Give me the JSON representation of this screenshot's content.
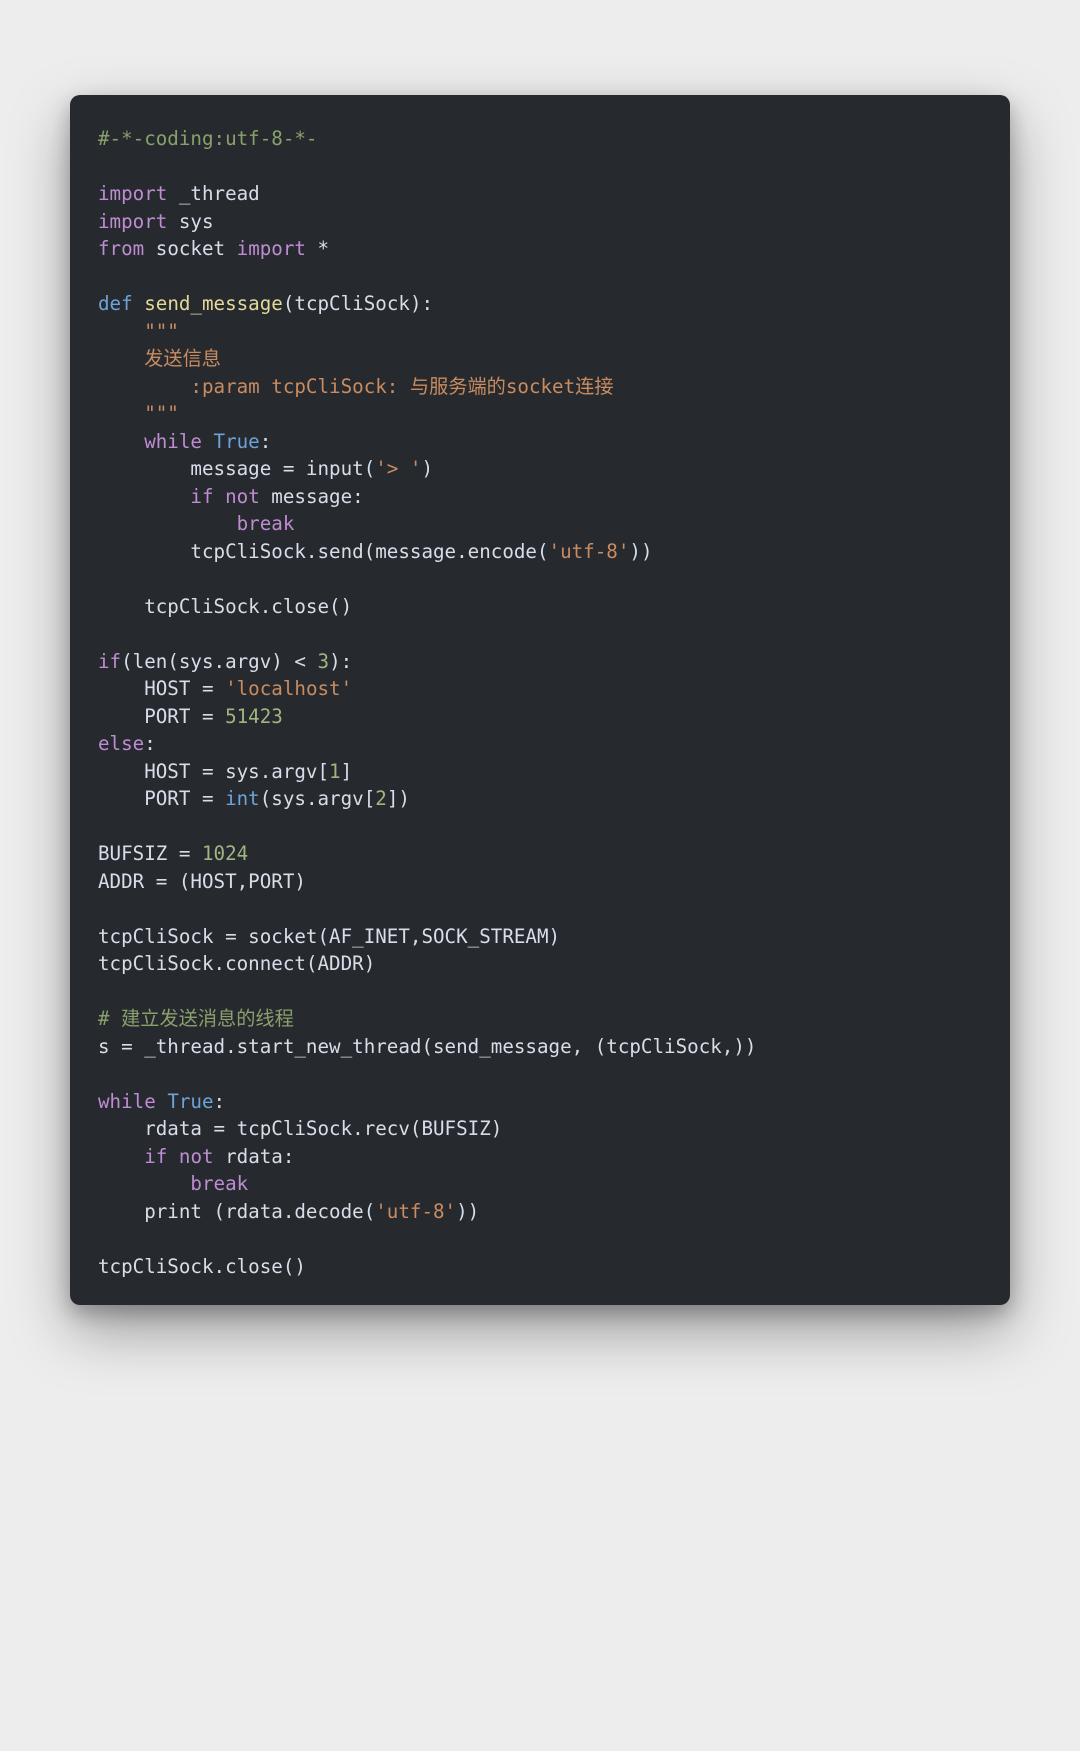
{
  "code": {
    "l01_comment": "#-*-coding:utf-8-*-",
    "l02_blank": "",
    "l03_import": "import",
    "l03_mod": " _thread",
    "l04_import": "import",
    "l04_mod": " sys",
    "l05_from": "from",
    "l05_mod": " socket ",
    "l05_import": "import",
    "l05_star": " *",
    "l06_blank": "",
    "l07_def": "def",
    "l07_space": " ",
    "l07_fn": "send_message",
    "l07_params_open": "(",
    "l07_param": "tcpCliSock",
    "l07_params_close": "):",
    "l08_doc": "    \"\"\"",
    "l09_doc": "    发送信息",
    "l10_doc": "        :param tcpCliSock: 与服务端的socket连接",
    "l11_doc": "    \"\"\"",
    "l12_while": "    while",
    "l12_space": " ",
    "l12_true": "True",
    "l12_colon": ":",
    "l13_indent": "        message = input(",
    "l13_str": "'> '",
    "l13_close": ")",
    "l14_indent": "        ",
    "l14_if": "if",
    "l14_space": " ",
    "l14_not": "not",
    "l14_rest": " message:",
    "l15_indent": "            ",
    "l15_break": "break",
    "l16_indent": "        tcpCliSock.send(message.encode(",
    "l16_str": "'utf-8'",
    "l16_close": "))",
    "l17_blank": "",
    "l18_line": "    tcpCliSock.close()",
    "l19_blank": "",
    "l20_if": "if",
    "l20_rest1": "(len(sys.argv) < ",
    "l20_num": "3",
    "l20_rest2": "):",
    "l21_indent": "    HOST = ",
    "l21_str": "'localhost'",
    "l22_indent": "    PORT = ",
    "l22_num": "51423",
    "l23_else": "else",
    "l23_colon": ":",
    "l24_line": "    HOST = sys.argv[",
    "l24_num": "1",
    "l24_close": "]",
    "l25_indent": "    PORT = ",
    "l25_int": "int",
    "l25_rest1": "(sys.argv[",
    "l25_num": "2",
    "l25_rest2": "])",
    "l26_blank": "",
    "l27_indent": "BUFSIZ = ",
    "l27_num": "1024",
    "l28_line": "ADDR = (HOST,PORT)",
    "l29_blank": "",
    "l30_line": "tcpCliSock = socket(AF_INET,SOCK_STREAM)",
    "l31_line": "tcpCliSock.connect(ADDR)",
    "l32_blank": "",
    "l33_comment": "# 建立发送消息的线程",
    "l34_line": "s = _thread.start_new_thread(send_message, (tcpCliSock,))",
    "l35_blank": "",
    "l36_while": "while",
    "l36_space": " ",
    "l36_true": "True",
    "l36_colon": ":",
    "l37_line": "    rdata = tcpCliSock.recv(BUFSIZ)",
    "l38_indent": "    ",
    "l38_if": "if",
    "l38_space": " ",
    "l38_not": "not",
    "l38_rest": " rdata:",
    "l39_indent": "        ",
    "l39_break": "break",
    "l40_indent": "    print (rdata.decode(",
    "l40_str": "'utf-8'",
    "l40_close": "))",
    "l41_blank": "",
    "l42_line": "tcpCliSock.close()"
  }
}
